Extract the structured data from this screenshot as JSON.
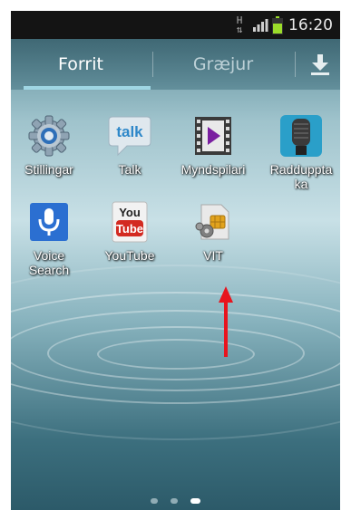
{
  "statusbar": {
    "time": "16:20",
    "network_label": "H"
  },
  "tabs": {
    "apps": "Forrit",
    "widgets": "Græjur"
  },
  "apps": [
    {
      "label": "Stillingar",
      "icon": "settings-gear-icon"
    },
    {
      "label": "Talk",
      "icon": "talk-icon"
    },
    {
      "label": "Myndspilari",
      "icon": "video-player-icon"
    },
    {
      "label": "Radduppta ka",
      "icon": "voice-recorder-icon"
    },
    {
      "label": "Voice Search",
      "icon": "voice-search-icon"
    },
    {
      "label": "YouTube",
      "icon": "youtube-icon"
    },
    {
      "label": "VIT",
      "icon": "sim-toolkit-icon"
    }
  ],
  "icon_texts": {
    "talk": "talk",
    "youtube_top": "You",
    "youtube_bottom": "Tube"
  },
  "annotation_color": "#e8141e"
}
